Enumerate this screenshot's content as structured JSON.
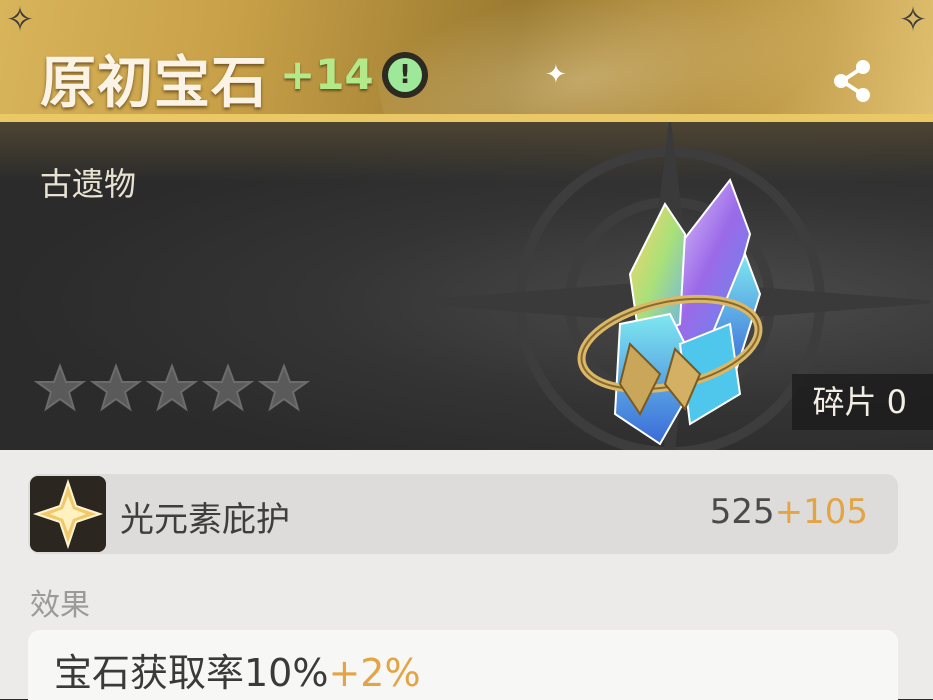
{
  "item": {
    "name": "原初宝石",
    "level": "+14",
    "warning_glyph": "!",
    "category": "古遗物",
    "stars_filled": 0,
    "stars_total": 5,
    "shards_label": "碎片",
    "shards_count": "0",
    "gem_icon": "crystal-ring-icon"
  },
  "stat": {
    "icon": "light-element-star-icon",
    "name": "光元素庇护",
    "value": "525",
    "bonus": "+105"
  },
  "effect": {
    "label": "效果",
    "text": "宝石获取率10%",
    "bonus": "+2%"
  },
  "colors": {
    "header_gold": "#c8a048",
    "bonus_orange": "#e3a445",
    "level_green": "#b4e98a"
  }
}
